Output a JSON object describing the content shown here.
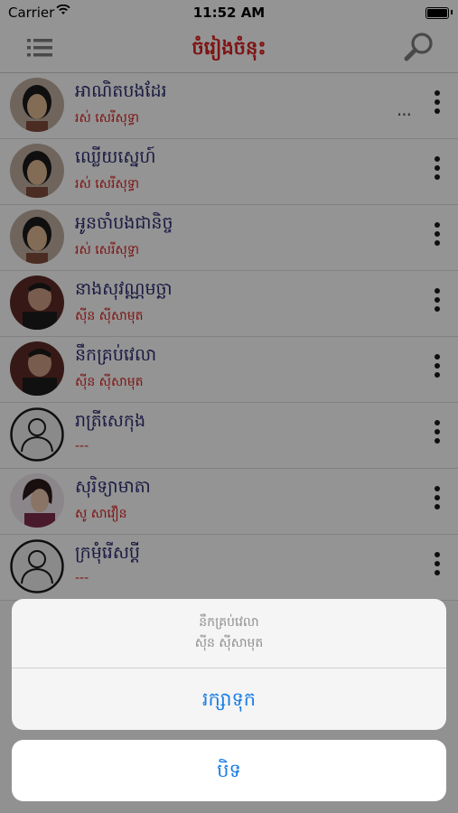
{
  "status_bar": {
    "carrier": "Carrier",
    "time": "11:52 AM"
  },
  "nav": {
    "title": "ចំរៀងចំនុះ",
    "menu_icon": "list-menu-icon",
    "search_icon": "search-icon"
  },
  "songs": [
    {
      "title": "អាណិតបងដែរ",
      "artist": "រស់ សេរីសុទ្ធា",
      "avatar": "female-singer-photo"
    },
    {
      "title": "ឈ្លើយស្នេហ៍",
      "artist": "រស់ សេរីសុទ្ធា",
      "avatar": "female-singer-photo"
    },
    {
      "title": "អូនចាំបងជានិច្ច",
      "artist": "រស់ សេរីសុទ្ធា",
      "avatar": "female-singer-photo"
    },
    {
      "title": "នាងសុវណ្ណមច្ឆា",
      "artist": "ស៊ីន ស៊ីសាមុត",
      "avatar": "male-singer-photo"
    },
    {
      "title": "នឹកគ្រប់វេលា",
      "artist": "ស៊ីន ស៊ីសាមុត",
      "avatar": "male-singer-photo"
    },
    {
      "title": "រាត្រីសេកុង",
      "artist": "---",
      "avatar": "placeholder-person-icon"
    },
    {
      "title": "សុរិទ្យាមាតា",
      "artist": "សូ សាវឿន",
      "avatar": "female-singer-photo-2"
    },
    {
      "title": "ក្រមុំរើសប្តី",
      "artist": "---",
      "avatar": "placeholder-person-icon"
    }
  ],
  "row_swipe_hint": "...",
  "action_sheet": {
    "song_title": "នឹកគ្រប់វេលា",
    "song_artist": "ស៊ីន ស៊ីសាមុត",
    "save_label": "រក្សាទុក",
    "cancel_label": "បិទ"
  },
  "colors": {
    "title_red": "#d32020",
    "song_blue": "#2a2a6e",
    "action_blue": "#1a7ee6"
  }
}
